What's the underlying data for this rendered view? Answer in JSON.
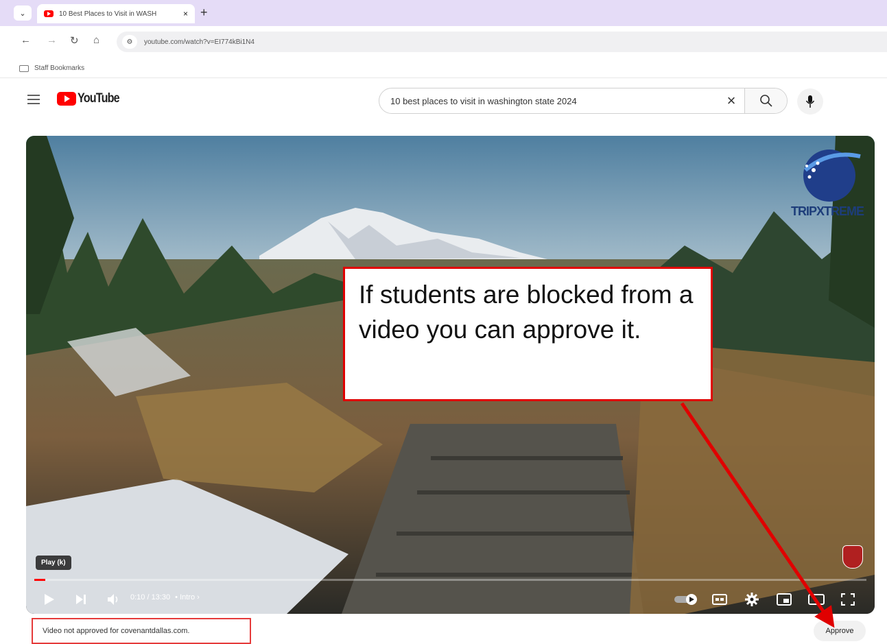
{
  "browser": {
    "tab_title": "10 Best Places to Visit in WASH",
    "tab_close": "×",
    "new_tab": "+",
    "url": "youtube.com/watch?v=EI774kBi1N4",
    "bookmarks_label": "Staff Bookmarks",
    "icons": [
      "tab-search-icon",
      "back-icon",
      "forward-icon",
      "reload-icon",
      "home-icon",
      "site-info-icon",
      "folder-icon"
    ]
  },
  "youtube": {
    "logo_text": "YouTube",
    "search": {
      "value": "10 best places to visit in washington state 2024",
      "clear": "×"
    }
  },
  "video": {
    "watermark_text": "TRIPXTREME",
    "tooltip": "Play (k)",
    "time": "0:10 / 13:30",
    "chapter": "• Intro ›",
    "progress_fraction": 0.013
  },
  "status": {
    "blocked_text": "Video not approved for covenantdallas.com.",
    "approve_label": "Approve"
  },
  "annotation": {
    "callout_text": "If students are blocked from a video you can approve it.",
    "color": "#e00000"
  }
}
